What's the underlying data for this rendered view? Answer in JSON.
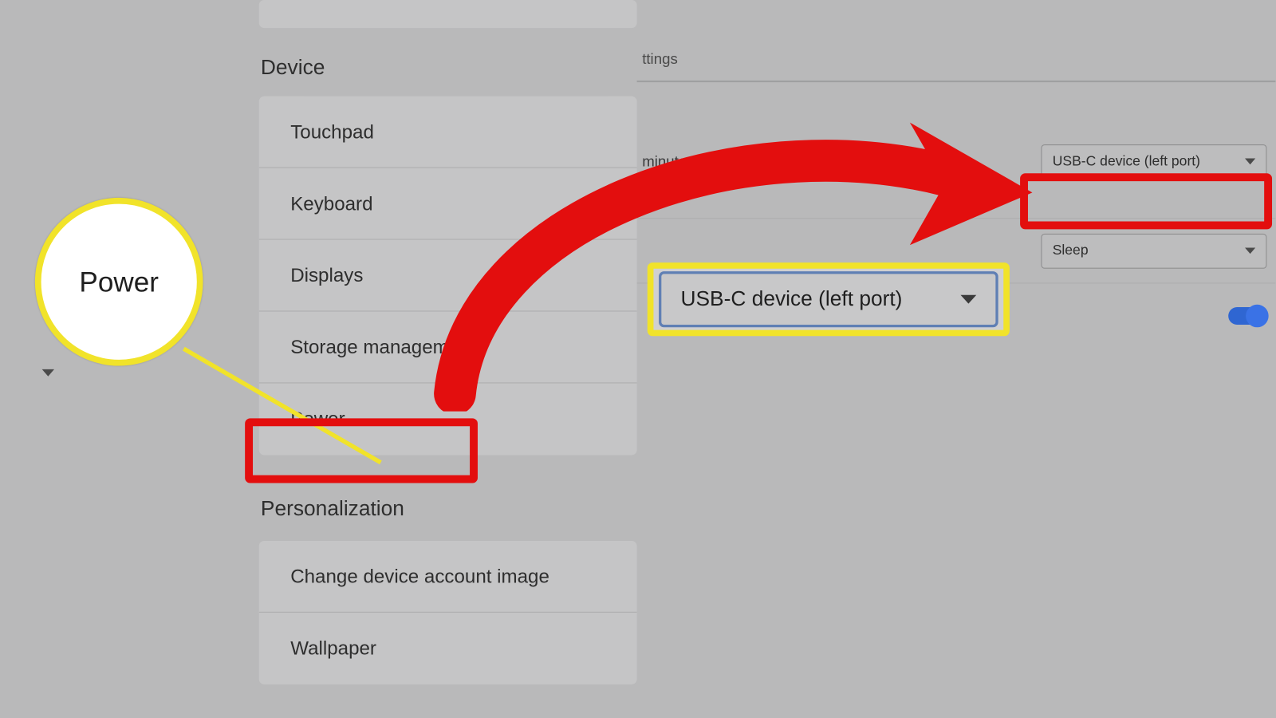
{
  "header": {
    "title_suffix": "ttings"
  },
  "section_device": {
    "title": "Device",
    "items": [
      {
        "label": "Touchpad"
      },
      {
        "label": "Keyboard"
      },
      {
        "label": "Displays"
      },
      {
        "label": "Storage management"
      },
      {
        "label": "Power"
      }
    ]
  },
  "section_personalization": {
    "title": "Personalization",
    "items": [
      {
        "label": "Change device account image"
      },
      {
        "label": "Wallpaper"
      }
    ]
  },
  "power": {
    "battery_status": "minutes left",
    "source_dropdown": "USB-C device (left port)",
    "idle_dropdown": "Sleep",
    "toggle_on": true
  },
  "callouts": {
    "circle_label": "Power",
    "big_dropdown": "USB-C device (left port)"
  }
}
